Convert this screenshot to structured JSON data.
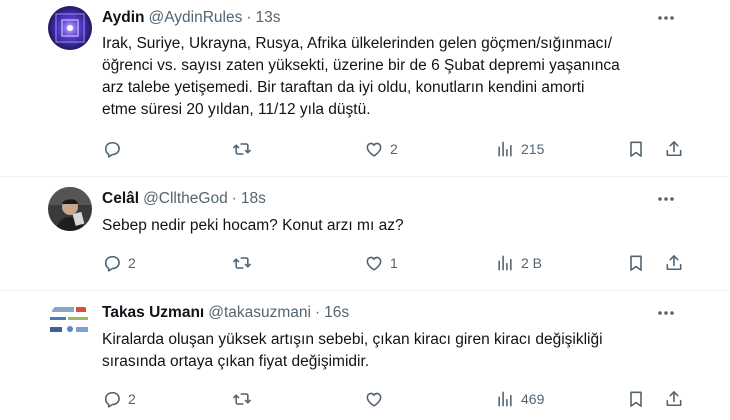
{
  "tweets": [
    {
      "name": "Aydin",
      "handle": "@AydinRules",
      "separator": "·",
      "time": "13s",
      "lines": [
        "Irak, Suriye, Ukrayna, Rusya, Afrika ülkelerinden gelen göçmen/sığınmacı/",
        "öğrenci vs. sayısı zaten yüksekti, üzerine bir de 6 Şubat depremi yaşanınca",
        "arz talebe yetişemedi. Bir taraftan da iyi oldu, konutların kendini amorti",
        "etme süresi 20 yıldan, 11/12 yıla düştü."
      ],
      "replies": "",
      "retweets": "",
      "likes": "2",
      "views": "215"
    },
    {
      "name": "Celâl",
      "handle": "@ClltheGod",
      "separator": "·",
      "time": "18s",
      "lines": [
        "Sebep nedir peki hocam? Konut arzı mı az?"
      ],
      "replies": "2",
      "retweets": "",
      "likes": "1",
      "views": "2 B"
    },
    {
      "name": "Takas Uzmanı",
      "handle": "@takasuzmani",
      "separator": "·",
      "time": "16s",
      "lines": [
        "Kiralarda oluşan yüksek artışın sebebi,  çıkan kiracı giren kiracı değişikliği",
        "sırasında ortaya çıkan fiyat değişimidir."
      ],
      "replies": "2",
      "retweets": "",
      "likes": "",
      "views": "469"
    }
  ],
  "icons": {
    "more": "more-horizontal-icon",
    "reply": "reply-icon",
    "retweet": "retweet-icon",
    "like": "heart-icon",
    "views": "views-icon",
    "bookmark": "bookmark-icon",
    "share": "share-icon"
  },
  "colors": {
    "text": "#0f1419",
    "secondary": "#536471",
    "divider": "#eff3f4"
  }
}
